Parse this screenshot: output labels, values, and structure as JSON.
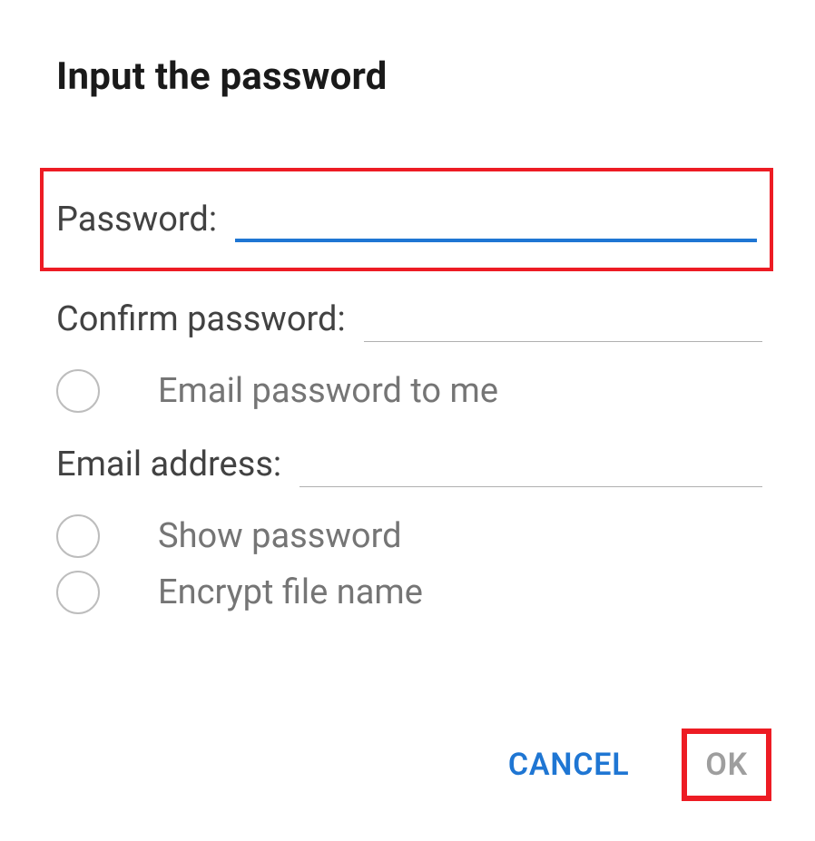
{
  "dialog": {
    "title": "Input the password",
    "password": {
      "label": "Password:",
      "value": ""
    },
    "confirm": {
      "label": "Confirm password:",
      "value": ""
    },
    "emailToMe": {
      "label": "Email password to me",
      "checked": false
    },
    "email": {
      "label": "Email address:",
      "value": ""
    },
    "showPassword": {
      "label": "Show password",
      "checked": false
    },
    "encryptFilename": {
      "label": "Encrypt file name",
      "checked": false
    },
    "actions": {
      "cancel": "CANCEL",
      "ok": "OK"
    },
    "highlights": {
      "passwordRow": true,
      "okButton": true
    },
    "colors": {
      "accent": "#1f76d3",
      "annotation": "#ed1c24"
    }
  }
}
